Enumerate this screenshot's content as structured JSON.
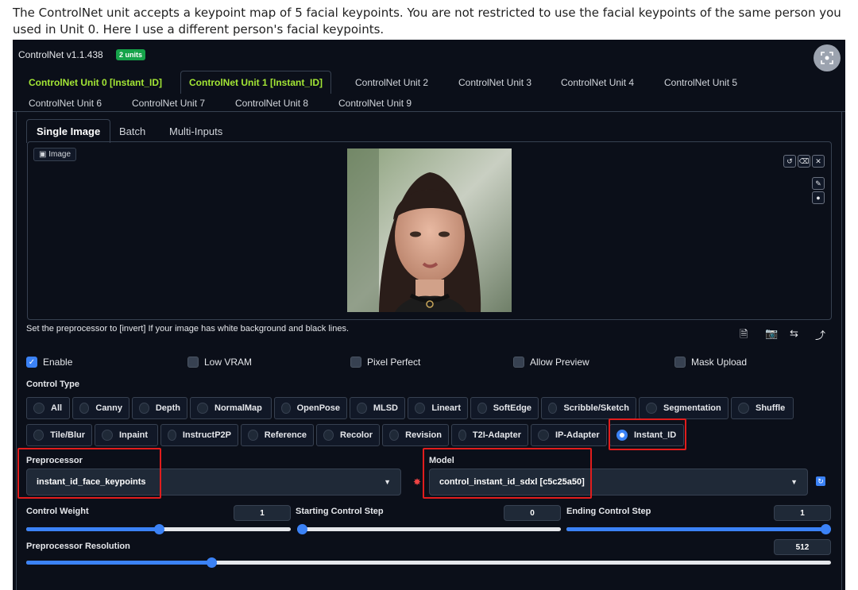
{
  "caption": "The ControlNet unit accepts a keypoint map of 5 facial keypoints. You are not restricted to use the facial keypoints of the same person you used in Unit 0. Here I use a different person's facial keypoints.",
  "header": {
    "title": "ControlNet v1.1.438",
    "badge": "2 units",
    "corner_icon": "camera-scan-icon"
  },
  "unit_tabs": [
    "ControlNet Unit 0 [Instant_ID]",
    "ControlNet Unit 1 [Instant_ID]",
    "ControlNet Unit 2",
    "ControlNet Unit 3",
    "ControlNet Unit 4",
    "ControlNet Unit 5",
    "ControlNet Unit 6",
    "ControlNet Unit 7",
    "ControlNet Unit 8",
    "ControlNet Unit 9"
  ],
  "selected_unit": "ControlNet Unit 1 [Instant_ID]",
  "input_tabs": [
    "Single Image",
    "Batch",
    "Multi-Inputs"
  ],
  "image_label": "Image",
  "image_tools": [
    "undo-icon",
    "erase-icon",
    "close-icon",
    "draw-icon",
    "color-icon"
  ],
  "hint": "Set the preprocessor to [invert] If your image has white background and black lines.",
  "actions": [
    "new-canvas-icon",
    "camera-icon",
    "swap-icon",
    "send-icon"
  ],
  "checks": [
    {
      "label": "Enable",
      "checked": true
    },
    {
      "label": "Low VRAM",
      "checked": false
    },
    {
      "label": "Pixel Perfect",
      "checked": false
    },
    {
      "label": "Allow Preview",
      "checked": false
    },
    {
      "label": "Mask Upload",
      "checked": false
    }
  ],
  "control_type_label": "Control Type",
  "control_types_row1": [
    "All",
    "Canny",
    "Depth",
    "NormalMap",
    "OpenPose",
    "MLSD",
    "Lineart",
    "SoftEdge",
    "Scribble/Sketch",
    "Segmentation",
    "Shuffle"
  ],
  "control_types_row2": [
    "Tile/Blur",
    "Inpaint",
    "InstructP2P",
    "Reference",
    "Recolor",
    "Revision",
    "T2I-Adapter",
    "IP-Adapter",
    "Instant_ID"
  ],
  "selected_control_type": "Instant_ID",
  "preprocessor": {
    "label": "Preprocessor",
    "value": "instant_id_face_keypoints"
  },
  "model": {
    "label": "Model",
    "value": "control_instant_id_sdxl [c5c25a50]"
  },
  "sliders": {
    "control_weight": {
      "label": "Control Weight",
      "value": "1",
      "fraction": 0.5
    },
    "starting_step": {
      "label": "Starting Control Step",
      "value": "0",
      "fraction": 0.0
    },
    "ending_step": {
      "label": "Ending Control Step",
      "value": "1",
      "fraction": 1.0
    },
    "resolution": {
      "label": "Preprocessor Resolution",
      "value": "512",
      "fraction": 0.23
    }
  },
  "colors": {
    "accent": "#3b82f6",
    "highlight": "#e11d1d",
    "active_tab": "#a3e635",
    "badge": "#16a34a"
  }
}
